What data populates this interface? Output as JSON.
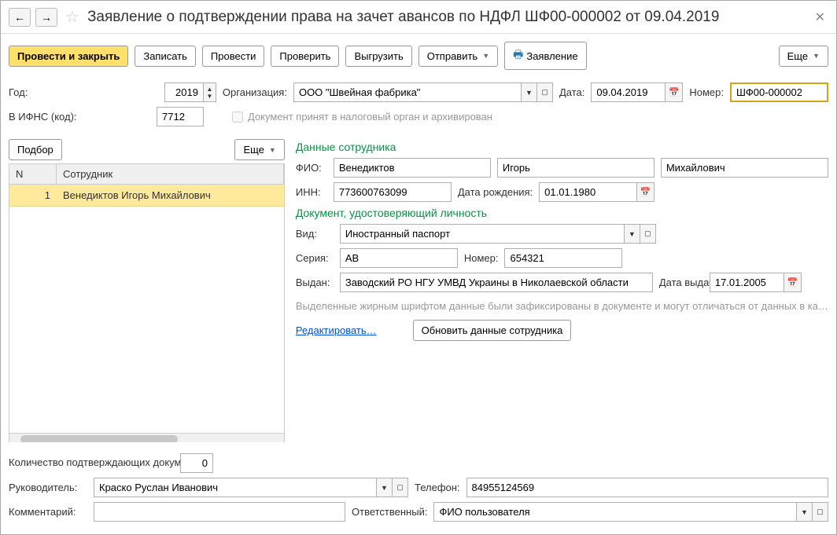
{
  "header": {
    "title": "Заявление о подтверждении права на зачет авансов по НДФЛ ШФ00-000002 от 09.04.2019"
  },
  "toolbar": {
    "post_close": "Провести и закрыть",
    "write": "Записать",
    "post": "Провести",
    "check": "Проверить",
    "export": "Выгрузить",
    "send": "Отправить",
    "app": "Заявление",
    "more": "Еще"
  },
  "row1": {
    "year_lbl": "Год:",
    "year": "2019",
    "org_lbl": "Организация:",
    "org": "ООО \"Швейная фабрика\"",
    "date_lbl": "Дата:",
    "date": "09.04.2019",
    "num_lbl": "Номер:",
    "num": "ШФ00-000002"
  },
  "row2": {
    "ifns_lbl": "В ИФНС (код):",
    "ifns": "7712",
    "archived": "Документ принят в налоговый орган и архивирован"
  },
  "left": {
    "select": "Подбор",
    "more": "Еще",
    "col_n": "N",
    "col_emp": "Сотрудник",
    "rows": [
      {
        "n": "1",
        "emp": "Венедиктов Игорь Михайлович"
      }
    ]
  },
  "emp": {
    "heading": "Данные сотрудника",
    "fio_lbl": "ФИО:",
    "last": "Венедиктов",
    "first": "Игорь",
    "middle": "Михайлович",
    "inn_lbl": "ИНН:",
    "inn": "773600763099",
    "bdate_lbl": "Дата рождения:",
    "bdate": "01.01.1980"
  },
  "doc": {
    "heading": "Документ, удостоверяющий личность",
    "kind_lbl": "Вид:",
    "kind": "Иностранный паспорт",
    "series_lbl": "Серия:",
    "series": "АВ",
    "num_lbl": "Номер:",
    "num": "654321",
    "issued_lbl": "Выдан:",
    "issued": "Заводский РО НГУ УМВД Украины в Николаевской области",
    "idate_lbl": "Дата выдачи:",
    "idate": "17.01.2005"
  },
  "note": "Выделенные жирным шрифтом данные были зафиксированы в документе и могут отличаться от данных в ка…",
  "actions": {
    "edit": "Редактировать…",
    "refresh": "Обновить данные сотрудника"
  },
  "bottom": {
    "qty_lbl": "Количество подтверждающих документов:",
    "qty": "0",
    "head_lbl": "Руководитель:",
    "head": "Краско Руслан Иванович",
    "phone_lbl": "Телефон:",
    "phone": "84955124569",
    "comment_lbl": "Комментарий:",
    "comment": "",
    "resp_lbl": "Ответственный:",
    "resp": "ФИО пользователя"
  }
}
